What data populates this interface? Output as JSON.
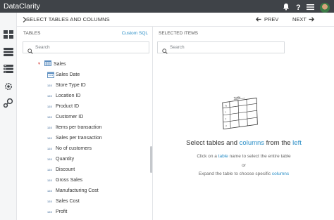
{
  "app": {
    "brand": "DataClarity"
  },
  "topbar": {
    "icons": [
      "bell-icon",
      "help-icon",
      "menu-icon",
      "avatar"
    ]
  },
  "left_rail": {
    "icons": [
      "dashboard-icon",
      "data-source-icon",
      "data-model-icon",
      "settings-cog-icon",
      "workflow-icon"
    ]
  },
  "wizard": {
    "title": "SELECT TABLES AND COLUMNS",
    "prev_label": "PREV",
    "next_label": "NEXT"
  },
  "tables_panel": {
    "title": "TABLES",
    "custom_sql_label": "Custom SQL",
    "search_placeholder": "Search",
    "table": {
      "name": "Sales",
      "expanded": true
    },
    "columns": [
      {
        "name": "Sales Date",
        "type": "date"
      },
      {
        "name": "Store Type ID",
        "type": "123"
      },
      {
        "name": "Location ID",
        "type": "123"
      },
      {
        "name": "Product ID",
        "type": "123"
      },
      {
        "name": "Customer ID",
        "type": "123"
      },
      {
        "name": "Items per transaction",
        "type": "123"
      },
      {
        "name": "Sales per transaction",
        "type": "123"
      },
      {
        "name": "No of customers",
        "type": "123"
      },
      {
        "name": "Quantity",
        "type": "123"
      },
      {
        "name": "Discount",
        "type": "123"
      },
      {
        "name": "Gross Sales",
        "type": "123"
      },
      {
        "name": "Manufacturing Cost",
        "type": "123"
      },
      {
        "name": "Sales Cost",
        "type": "123"
      },
      {
        "name": "Profit",
        "type": "123"
      }
    ]
  },
  "selected_panel": {
    "title": "SELECTED ITEMS",
    "search_placeholder": "Search",
    "illustration_label": "Table",
    "empty_title": {
      "part1": "Select tables and ",
      "link1": "columns",
      "part2": " from the ",
      "link2": "left"
    },
    "hint1": {
      "part1": "Click on a ",
      "link": "table",
      "part2": " name to select the entire table"
    },
    "hint_or": "or",
    "hint2": {
      "part1": "Expand the table to choose specific ",
      "link": "columns"
    }
  },
  "colors": {
    "topbar": "#3f4348",
    "accent": "#2a8ec6",
    "caret": "#d9534f"
  }
}
